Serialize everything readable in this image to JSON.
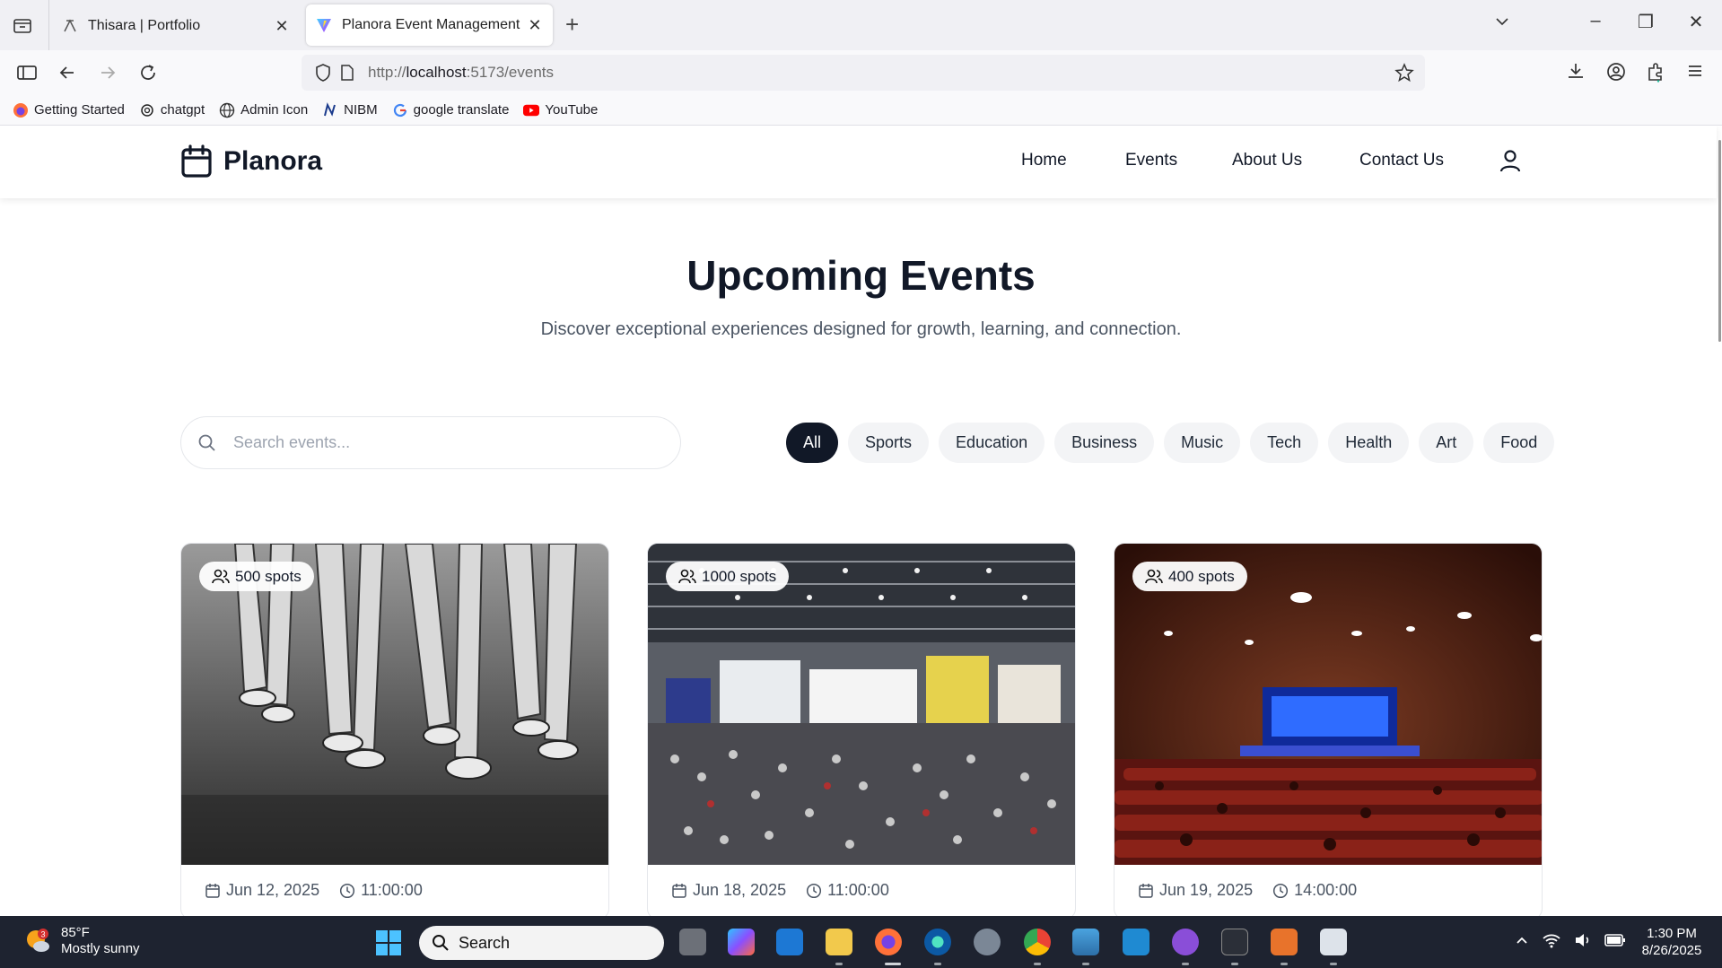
{
  "browser": {
    "tabs": [
      {
        "title": "Thisara | Portfolio",
        "active": false
      },
      {
        "title": "Planora Event Management Platform",
        "active": true
      }
    ],
    "url": {
      "prefix": "http://",
      "host": "localhost",
      "rest": ":5173/events"
    },
    "bookmarks": [
      {
        "label": "Getting Started",
        "icon": "firefox-icon"
      },
      {
        "label": "chatgpt",
        "icon": "openai-icon"
      },
      {
        "label": "Admin Icon",
        "icon": "globe-icon"
      },
      {
        "label": "NIBM",
        "icon": "nibm-icon"
      },
      {
        "label": "google translate",
        "icon": "google-icon"
      },
      {
        "label": "YouTube",
        "icon": "youtube-icon"
      }
    ]
  },
  "site": {
    "brand": "Planora",
    "nav": [
      "Home",
      "Events",
      "About Us",
      "Contact Us"
    ],
    "title": "Upcoming Events",
    "subtitle": "Discover exceptional experiences designed for growth, learning, and connection.",
    "search_placeholder": "Search events...",
    "filters": [
      "All",
      "Sports",
      "Education",
      "Business",
      "Music",
      "Tech",
      "Health",
      "Art",
      "Food"
    ],
    "active_filter": "All",
    "events": [
      {
        "spots": "500 spots",
        "date": "Jun 12, 2025",
        "time": "11:00:00",
        "image": "marathon-runners"
      },
      {
        "spots": "1000 spots",
        "date": "Jun 18, 2025",
        "time": "11:00:00",
        "image": "exhibition-hall"
      },
      {
        "spots": "400 spots",
        "date": "Jun 19, 2025",
        "time": "14:00:00",
        "image": "auditorium-stage"
      }
    ]
  },
  "taskbar": {
    "weather": {
      "temp": "85°F",
      "desc": "Mostly sunny",
      "badge": "3"
    },
    "search_label": "Search",
    "time": "1:30 PM",
    "date": "8/26/2025"
  },
  "colors": {
    "accent": "#111827",
    "chip_bg": "#f3f4f6",
    "taskbar": "#1e2330"
  }
}
